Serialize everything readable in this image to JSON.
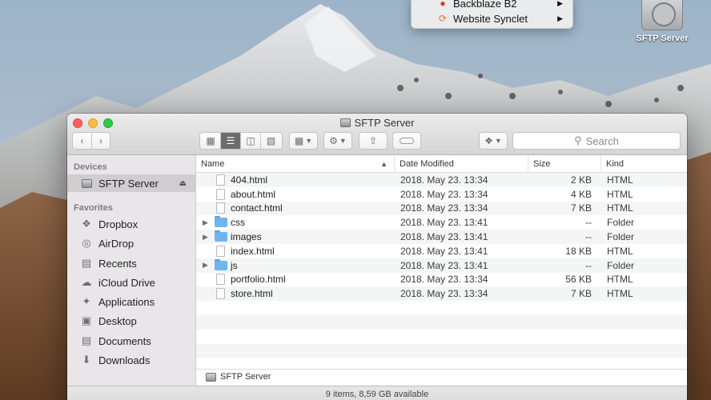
{
  "context_menu": {
    "items": [
      {
        "label": "Backblaze B2",
        "icon": "backblaze-flame-icon"
      },
      {
        "label": "Website Synclet",
        "icon": "sync-icon"
      }
    ]
  },
  "desktop": {
    "drive_label": "SFTP Server"
  },
  "window": {
    "title": "SFTP Server",
    "search_placeholder": "Search",
    "toolbar": {
      "view_modes": [
        "icon-view",
        "list-view",
        "column-view",
        "gallery-view"
      ],
      "active_view": "list-view"
    }
  },
  "sidebar": {
    "devices_heading": "Devices",
    "device": {
      "label": "SFTP Server",
      "icon": "drive-icon"
    },
    "favorites_heading": "Favorites",
    "favorites": [
      {
        "label": "Dropbox",
        "icon": "dropbox-icon"
      },
      {
        "label": "AirDrop",
        "icon": "airdrop-icon"
      },
      {
        "label": "Recents",
        "icon": "recents-icon"
      },
      {
        "label": "iCloud Drive",
        "icon": "cloud-icon"
      },
      {
        "label": "Applications",
        "icon": "applications-icon"
      },
      {
        "label": "Desktop",
        "icon": "desktop-icon"
      },
      {
        "label": "Documents",
        "icon": "documents-icon"
      },
      {
        "label": "Downloads",
        "icon": "downloads-icon"
      }
    ]
  },
  "list": {
    "columns": {
      "name": "Name",
      "date": "Date Modified",
      "size": "Size",
      "kind": "Kind"
    },
    "rows": [
      {
        "name": "404.html",
        "date": "2018. May 23. 13:34",
        "size": "2 KB",
        "kind": "HTML",
        "folder": false
      },
      {
        "name": "about.html",
        "date": "2018. May 23. 13:34",
        "size": "4 KB",
        "kind": "HTML",
        "folder": false
      },
      {
        "name": "contact.html",
        "date": "2018. May 23. 13:34",
        "size": "7 KB",
        "kind": "HTML",
        "folder": false
      },
      {
        "name": "css",
        "date": "2018. May 23. 13:41",
        "size": "--",
        "kind": "Folder",
        "folder": true
      },
      {
        "name": "images",
        "date": "2018. May 23. 13:41",
        "size": "--",
        "kind": "Folder",
        "folder": true
      },
      {
        "name": "index.html",
        "date": "2018. May 23. 13:41",
        "size": "18 KB",
        "kind": "HTML",
        "folder": false
      },
      {
        "name": "js",
        "date": "2018. May 23. 13:41",
        "size": "--",
        "kind": "Folder",
        "folder": true
      },
      {
        "name": "portfolio.html",
        "date": "2018. May 23. 13:34",
        "size": "56 KB",
        "kind": "HTML",
        "folder": false
      },
      {
        "name": "store.html",
        "date": "2018. May 23. 13:34",
        "size": "7 KB",
        "kind": "HTML",
        "folder": false
      }
    ]
  },
  "path_bar": {
    "label": "SFTP Server"
  },
  "status": {
    "text": "9 items, 8,59 GB available"
  }
}
